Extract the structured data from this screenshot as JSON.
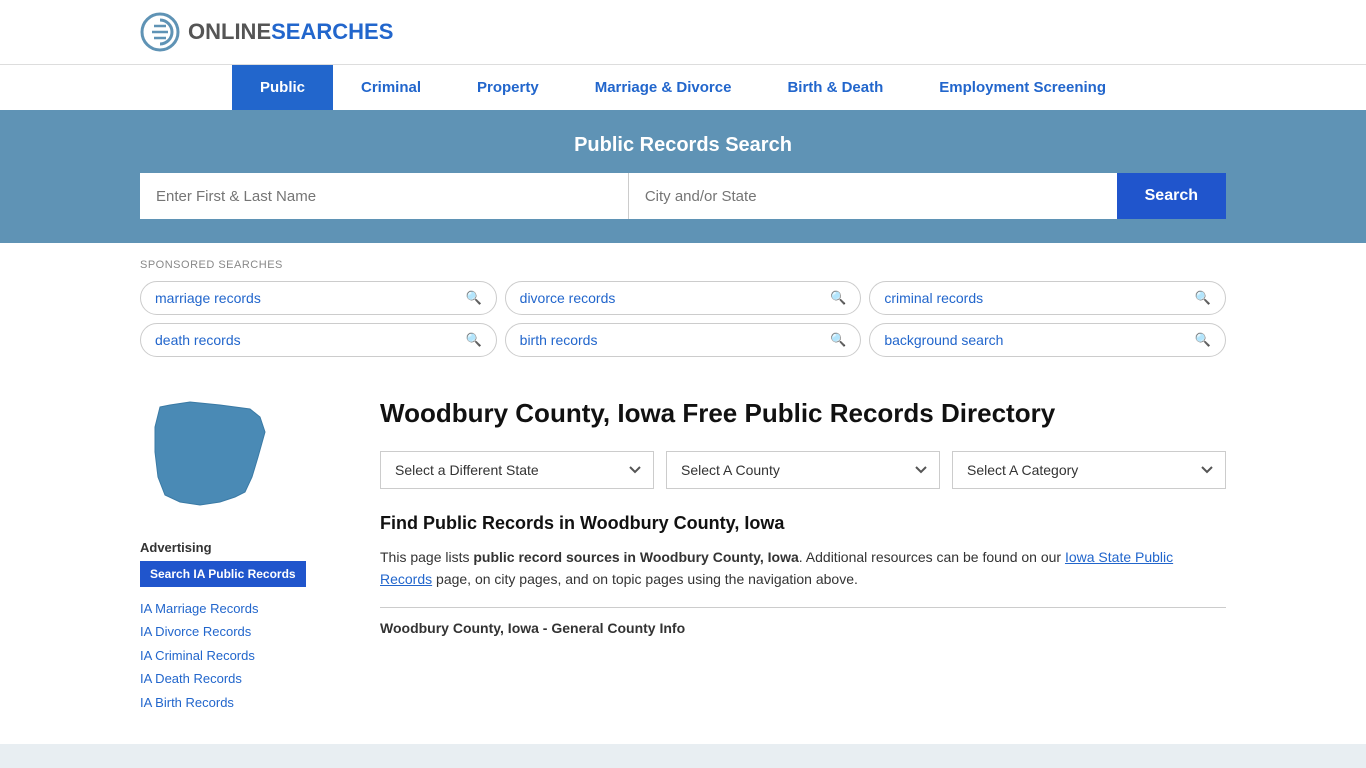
{
  "header": {
    "logo_online": "ONLINE",
    "logo_searches": "SEARCHES"
  },
  "nav": {
    "items": [
      {
        "label": "Public",
        "active": true
      },
      {
        "label": "Criminal",
        "active": false
      },
      {
        "label": "Property",
        "active": false
      },
      {
        "label": "Marriage & Divorce",
        "active": false
      },
      {
        "label": "Birth & Death",
        "active": false
      },
      {
        "label": "Employment Screening",
        "active": false
      }
    ]
  },
  "search_banner": {
    "title": "Public Records Search",
    "name_placeholder": "Enter First & Last Name",
    "location_placeholder": "City and/or State",
    "button_label": "Search"
  },
  "sponsored": {
    "label": "SPONSORED SEARCHES",
    "tags": [
      "marriage records",
      "divorce records",
      "criminal records",
      "death records",
      "birth records",
      "background search"
    ]
  },
  "content": {
    "page_title": "Woodbury County, Iowa Free Public Records Directory",
    "dropdowns": {
      "state": "Select a Different State",
      "county": "Select A County",
      "category": "Select A Category"
    },
    "find_title": "Find Public Records in Woodbury County, Iowa",
    "description_start": "This page lists ",
    "description_bold": "public record sources in Woodbury County, Iowa",
    "description_middle": ". Additional resources can be found on our ",
    "description_link": "Iowa State Public Records",
    "description_end": " page, on city pages, and on topic pages using the navigation above.",
    "county_info_label": "Woodbury County, Iowa - General County Info"
  },
  "sidebar": {
    "advertising_label": "Advertising",
    "ad_button": "Search IA Public Records",
    "links": [
      "IA Marriage Records",
      "IA Divorce Records",
      "IA Criminal Records",
      "IA Death Records",
      "IA Birth Records"
    ]
  }
}
